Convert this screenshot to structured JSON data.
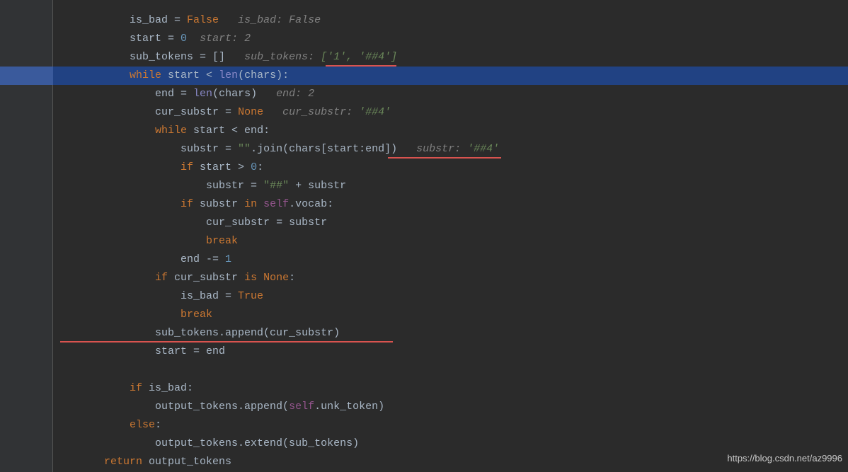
{
  "watermark": "https://blog.csdn.net/az9996",
  "indent": {
    "l3": "            ",
    "l4": "                ",
    "l5": "                    ",
    "l6": "                        ",
    "l2": "        "
  },
  "code": {
    "l1": {
      "a": "is_bad = ",
      "b": "False",
      "hint": "   is_bad: False"
    },
    "l2": {
      "a": "start = ",
      "b": "0",
      "hint": "  start: 2"
    },
    "l3": {
      "a": "sub_tokens = []",
      "hint": "   sub_tokens: ",
      "hintval": "['1', '##4']"
    },
    "l4": {
      "kw": "while",
      "a": " start < ",
      "fn": "len",
      "b": "(chars):"
    },
    "l5": {
      "a": "end = ",
      "fn": "len",
      "b": "(chars)",
      "hint": "   end: 2"
    },
    "l6": {
      "a": "cur_substr = ",
      "b": "None",
      "hint": "   cur_substr: ",
      "hintval": "'##4'"
    },
    "l7": {
      "kw": "while",
      "a": " start < end:"
    },
    "l8": {
      "a": "substr = ",
      "str": "\"\"",
      "b": ".join(chars[start:end])",
      "hint": "   substr: ",
      "hintval": "'##4'"
    },
    "l9": {
      "kw": "if",
      "a": " start > ",
      "num": "0",
      "b": ":"
    },
    "l10": {
      "a": "substr = ",
      "str": "\"##\"",
      "b": " + substr"
    },
    "l11": {
      "kw": "if",
      "a": " substr ",
      "kw2": "in",
      "b": " ",
      "self": "self",
      "c": ".vocab:"
    },
    "l12": {
      "a": "cur_substr = substr"
    },
    "l13": {
      "kw": "break"
    },
    "l14": {
      "a": "end -= ",
      "num": "1"
    },
    "l15": {
      "kw": "if",
      "a": " cur_substr ",
      "kw2": "is",
      "b": " ",
      "none": "None",
      "c": ":"
    },
    "l16": {
      "a": "is_bad = ",
      "b": "True"
    },
    "l17": {
      "kw": "break"
    },
    "l18": {
      "a": "sub_tokens.append(cur_substr)"
    },
    "l19": {
      "a": "start = end"
    },
    "l20": {
      "kw": "if",
      "a": " is_bad:"
    },
    "l21": {
      "a": "output_tokens.append(",
      "self": "self",
      "b": ".unk_token)"
    },
    "l22": {
      "kw": "else",
      "a": ":"
    },
    "l23": {
      "a": "output_tokens.extend(sub_tokens)"
    },
    "l24": {
      "kw": "return",
      "a": " output_tokens"
    }
  }
}
